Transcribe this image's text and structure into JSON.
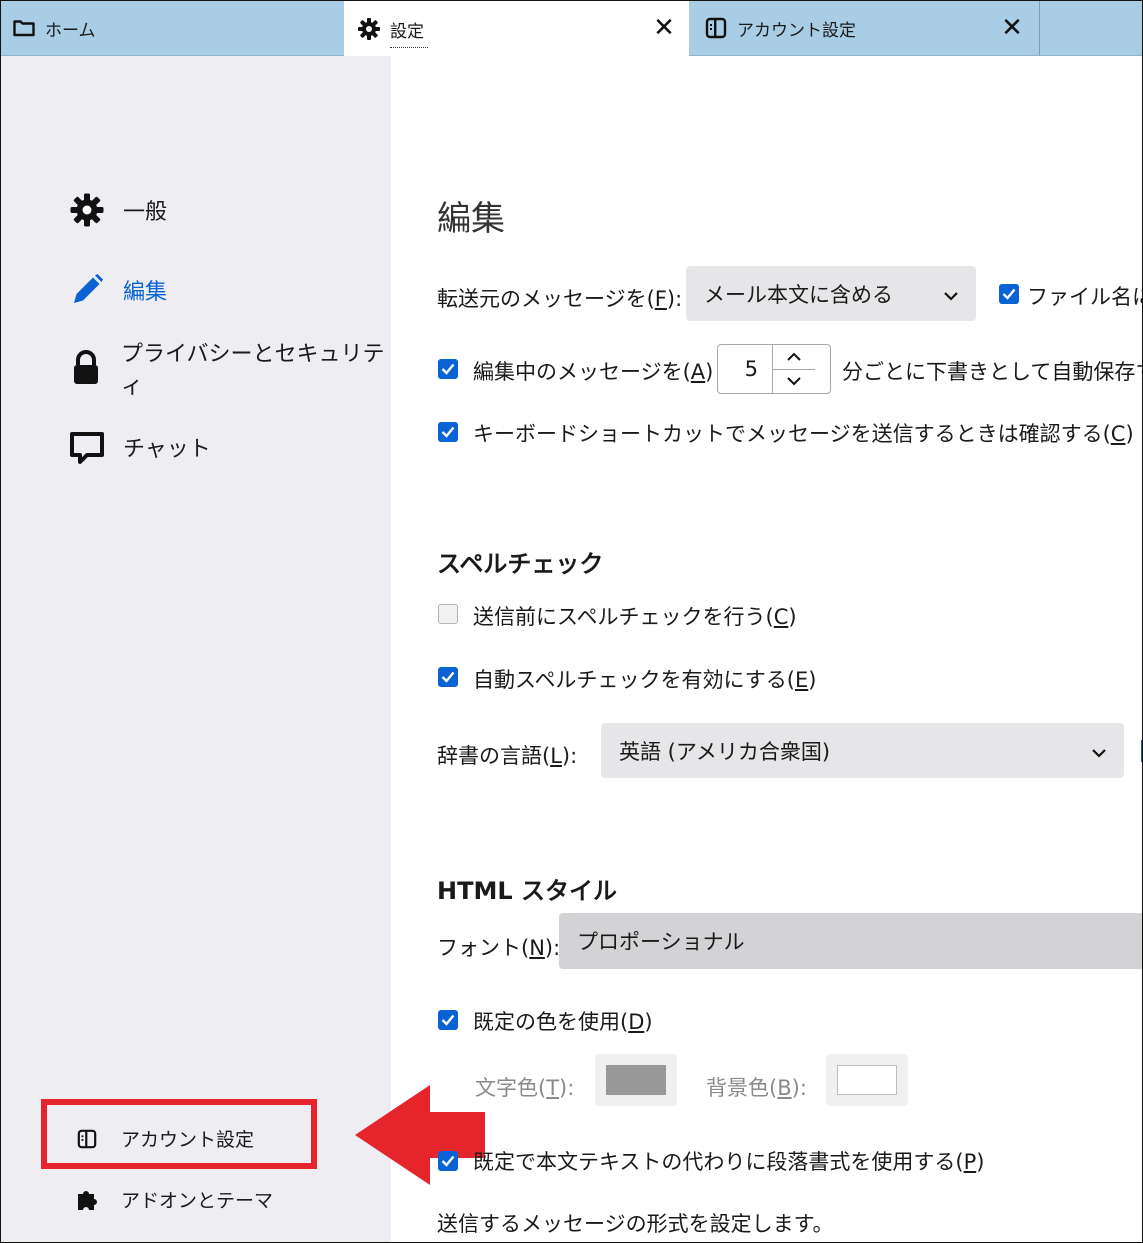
{
  "tabs": {
    "home": "ホーム",
    "settings": "設定",
    "account": "アカウント設定",
    "close": "✕"
  },
  "sidebar": {
    "items": [
      {
        "label": "一般",
        "icon": "gear-icon"
      },
      {
        "label": "編集",
        "icon": "pencil-icon"
      },
      {
        "label": "プライバシーとセキュリティ",
        "icon": "lock-icon"
      },
      {
        "label": "チャット",
        "icon": "chat-icon"
      }
    ],
    "account_settings": "アカウント設定",
    "addons": "アドオンとテーマ"
  },
  "main": {
    "title": "編集",
    "forward": {
      "label": "転送元のメッセージを(",
      "key": "F",
      "label_end": "):",
      "value": "メール本文に含める",
      "filename_label": "ファイル名に"
    },
    "autosave": {
      "label": "編集中のメッセージを(",
      "key": "A",
      "label_end": ")",
      "value": "5",
      "suffix": "分ごとに下書きとして自動保存する"
    },
    "confirm_shortcut": {
      "label": "キーボードショートカットでメッセージを送信するときは確認する(",
      "key": "C",
      "label_end": ")"
    },
    "spell_section": "スペルチェック",
    "spell_before_send": {
      "label": "送信前にスペルチェックを行う(",
      "key": "C",
      "label_end": ")"
    },
    "auto_spell": {
      "label": "自動スペルチェックを有効にする(",
      "key": "E",
      "label_end": ")"
    },
    "dictionary": {
      "label": "辞書の言語(",
      "key": "L",
      "label_end": "):",
      "value": "英語 (アメリカ合衆国)"
    },
    "html_section": "HTML スタイル",
    "font": {
      "label": "フォント(",
      "key": "N",
      "label_end": "):",
      "value": "プロポーショナル"
    },
    "default_colors": {
      "label": "既定の色を使用(",
      "key": "D",
      "label_end": ")"
    },
    "text_color": {
      "label": "文字色(",
      "key": "T",
      "label_end": "):"
    },
    "bg_color": {
      "label": "背景色(",
      "key": "B",
      "label_end": "):"
    },
    "paragraph": {
      "label": "既定で本文テキストの代わりに段落書式を使用する(",
      "key": "P",
      "label_end": ")"
    },
    "format_note": "送信するメッセージの形式を設定します。"
  },
  "colors": {
    "accent": "#0a63d4",
    "tabbar": "#a8cde4",
    "sidebar": "#ededf2",
    "highlight": "#e5242b",
    "text_color_swatch": "#999999",
    "bg_color_swatch": "#ffffff"
  }
}
